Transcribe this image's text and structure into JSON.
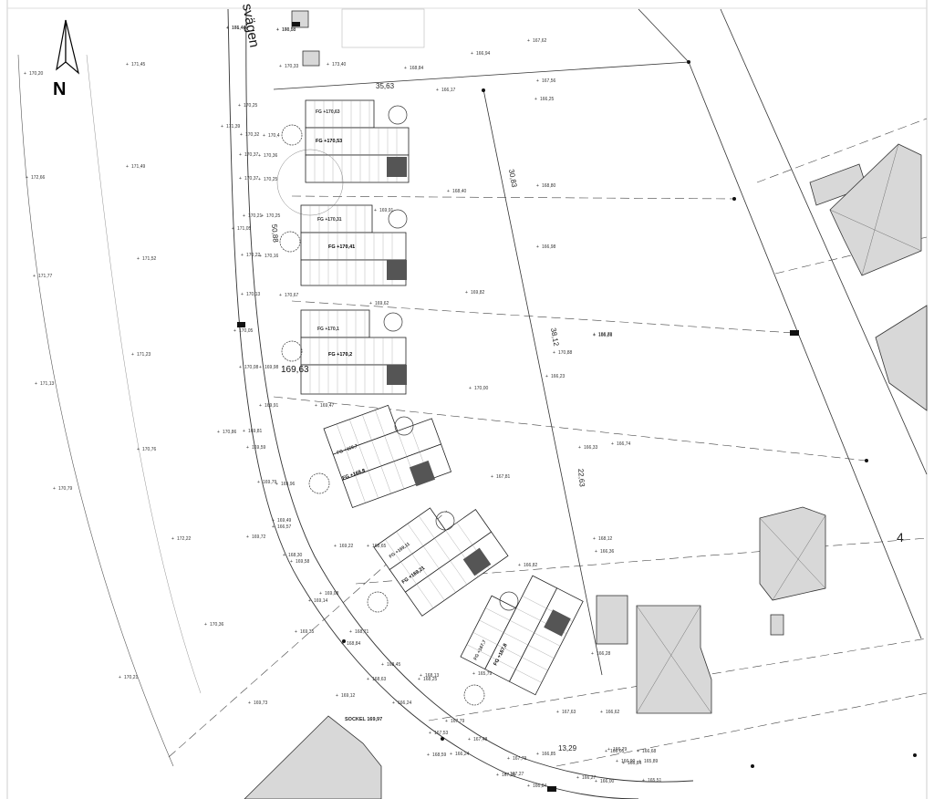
{
  "street_name": "svägen",
  "north_label": "N",
  "block_number": "4",
  "sockel_label": "SOCKEL 169,97",
  "lot_dimensions": [
    "35,63",
    "30,83",
    "50,88",
    "38,12",
    "22,63",
    "13,29"
  ],
  "center_height": "169,63",
  "fg_labels": [
    "FG +170,53",
    "FG +170,41",
    "FG +170,2",
    "FG +169,8",
    "FG +169,21",
    "FG +167,8"
  ],
  "small_fg_labels": [
    "FG +170,63",
    "FG +170,31",
    "FG +170,1",
    "FG +169,7",
    "FG +169,11",
    "FG +167,7"
  ],
  "spot_heights": [
    "171,44",
    "170,08",
    "170,33",
    "170,20",
    "171,45",
    "173,40",
    "168,84",
    "167,62",
    "166,94",
    "166,17",
    "167,56",
    "166,25",
    "170,25",
    "171,39",
    "170,32",
    "170,4",
    "170,37",
    "170,36",
    "168,40",
    "171,49",
    "170,37",
    "170,25",
    "172,66",
    "168,80",
    "171,05",
    "170,21",
    "170,25",
    "169,91",
    "171,52",
    "170,22",
    "170,16",
    "166,98",
    "171,77",
    "170,13",
    "170,67",
    "169,62",
    "169,82",
    "170,05",
    "171,23",
    "170,08",
    "169,98",
    "170,88",
    "166,86",
    "169,47",
    "171,13",
    "169,91",
    "170,86",
    "166,33",
    "169,81",
    "170,76",
    "169,59",
    "166,74",
    "167,81",
    "169,96",
    "169,79",
    "166,23",
    "170,00",
    "169,49",
    "166,57",
    "170,79",
    "169,72",
    "169,22",
    "168,65",
    "172,22",
    "168,30",
    "169,58",
    "166,82",
    "169,08",
    "169,14",
    "170,36",
    "168,71",
    "169,35",
    "168,84",
    "168,45",
    "168,25",
    "168,13",
    "170,21",
    "168,63",
    "169,12",
    "167,79",
    "166,24",
    "169,73",
    "167,53",
    "167,48",
    "168,59",
    "166,24",
    "167,79",
    "166,85",
    "166,05",
    "167,27",
    "167,16",
    "166,79",
    "166,90",
    "166,27",
    "166,00",
    "165,51",
    "166,84",
    "166,68",
    "167,63",
    "166,84",
    "165,89",
    "165,79",
    "166,79",
    "168,12",
    "166,36",
    "166,62",
    "166,28",
    "166,46",
    "166,53"
  ]
}
